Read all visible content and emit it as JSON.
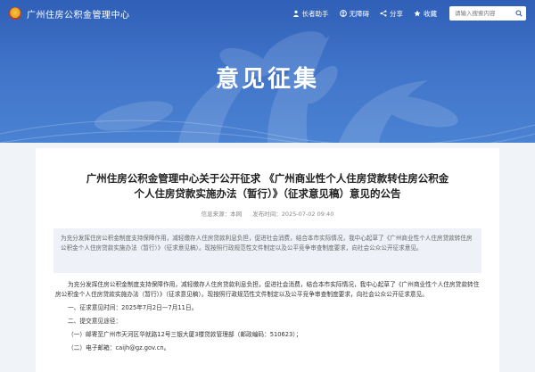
{
  "header": {
    "site_name": "广州住房公积金管理中心",
    "links": {
      "elder": "长者助手",
      "accessibility": "无障碍",
      "share": "分享",
      "favorite": "收藏"
    },
    "search": {
      "placeholder": "请输入搜索内容",
      "icon": "search-icon"
    }
  },
  "banner": {
    "title": "意见征集"
  },
  "article": {
    "title": "广州住房公积金管理中心关于公开征求 《广州商业性个人住房贷款转住房公积金 个人住房贷款实施办法（暂行）》（征求意见稿）意见的公告",
    "meta": {
      "source": "信息来源：本网",
      "date": "发布时间：2025-07-02 09:40"
    },
    "summary": "为充分发挥住房公积金制度支持保障作用，减轻缴存人住房贷款利息负担，促进社会消费，结合本市实际情况，我中心起草了《广州商业性个人住房贷款转住房公积金个人住房贷款实施办法（暂行）》（征求意见稿）。现按照行政规范性文件制定以及公平竞争审查制度要求，向社会公众公开征求意见。",
    "body": {
      "intro": "为充分发挥住房公积金制度支持保障作用，减轻缴存人住房贷款利息负担，促进社会消费，结合本市实际情况，我中心起草了《广州商业性个人住房贷款转住房公积金个人住房贷款实施办法（暂行）》（征求意见稿）。现按照行政规范性文件制定以及公平竞争审查制度要求，向社会公众公开征求意见。",
      "period": "一、征求意见时间：2025年7月2日—7月11日。",
      "channels": "二、提交意见途径：",
      "mail": "（一）邮寄至广州市天河区华就路12号三银大厦3楼贷款管理部（邮政编码：510623）；",
      "email": "（二）电子邮箱：caijh@gz.gov.cn。"
    }
  }
}
